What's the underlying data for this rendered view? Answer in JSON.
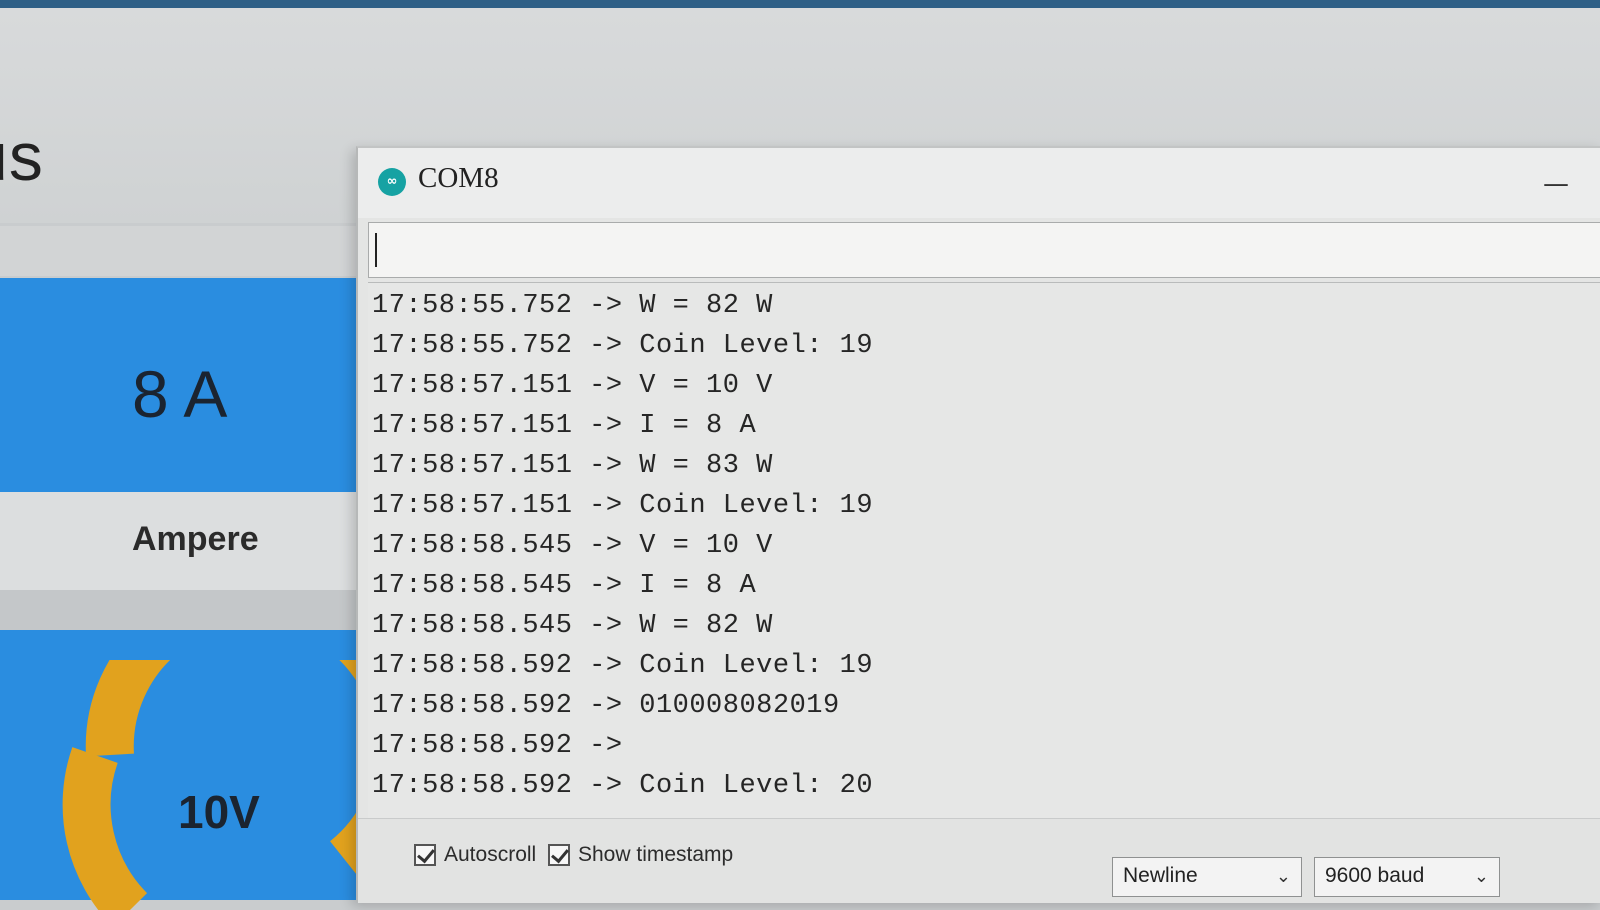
{
  "dashboard": {
    "title_fragment": "us",
    "current_value": "8 A",
    "current_label": "Ampere",
    "voltage_value": "10V",
    "accent_color": "#2a8de0",
    "gauge_color": "#e1a21e"
  },
  "monitor": {
    "icon": "arduino-infinity-icon",
    "icon_glyph": "∞",
    "title": "COM8",
    "minimize_glyph": "—",
    "input_value": "",
    "lines": [
      "17:58:55.752 -> W = 82 W",
      "17:58:55.752 -> Coin Level: 19",
      "17:58:57.151 -> V = 10 V",
      "17:58:57.151 -> I = 8 A",
      "17:58:57.151 -> W = 83 W",
      "17:58:57.151 -> Coin Level: 19",
      "17:58:58.545 -> V = 10 V",
      "17:58:58.545 -> I = 8 A",
      "17:58:58.545 -> W = 82 W",
      "17:58:58.592 -> Coin Level: 19",
      "17:58:58.592 -> 010008082019",
      "17:58:58.592 ->",
      "17:58:58.592 -> Coin Level: 20"
    ],
    "autoscroll_label": "Autoscroll",
    "autoscroll_checked": true,
    "timestamp_label": "Show timestamp",
    "timestamp_checked": true,
    "line_ending": "Newline",
    "baud_rate": "9600 baud",
    "dropdown_glyph": "⌄"
  }
}
